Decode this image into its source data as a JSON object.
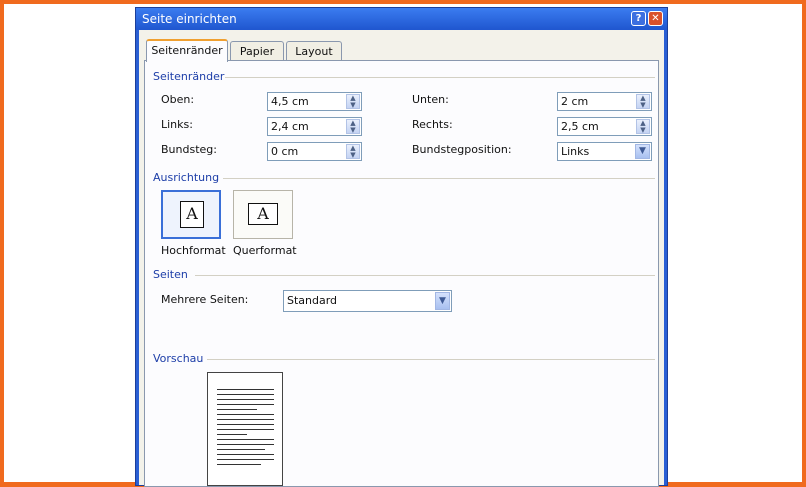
{
  "dialog": {
    "title": "Seite einrichten",
    "help_label": "?",
    "close_label": "✕"
  },
  "tabs": [
    {
      "label": "Seitenränder",
      "active": true
    },
    {
      "label": "Papier",
      "active": false
    },
    {
      "label": "Layout",
      "active": false
    }
  ],
  "margins": {
    "group_label": "Seitenränder",
    "top": {
      "label": "Oben:",
      "value": "4,5 cm"
    },
    "left": {
      "label": "Links:",
      "value": "2,4 cm"
    },
    "gutter": {
      "label": "Bundsteg:",
      "value": "0 cm"
    },
    "bottom": {
      "label": "Unten:",
      "value": "2 cm"
    },
    "right": {
      "label": "Rechts:",
      "value": "2,5 cm"
    },
    "gutter_position": {
      "label": "Bundstegposition:",
      "value": "Links"
    }
  },
  "orientation": {
    "group_label": "Ausrichtung",
    "portrait": {
      "label": "Hochformat",
      "glyph": "A",
      "selected": true
    },
    "landscape": {
      "label": "Querformat",
      "glyph": "A",
      "selected": false
    }
  },
  "pages": {
    "group_label": "Seiten",
    "multiple": {
      "label": "Mehrere Seiten:",
      "value": "Standard"
    }
  },
  "preview": {
    "group_label": "Vorschau"
  },
  "colors": {
    "frame": "#f06a1e",
    "titlebar": "#2a5fd4",
    "group_label": "#1d3ea8"
  }
}
